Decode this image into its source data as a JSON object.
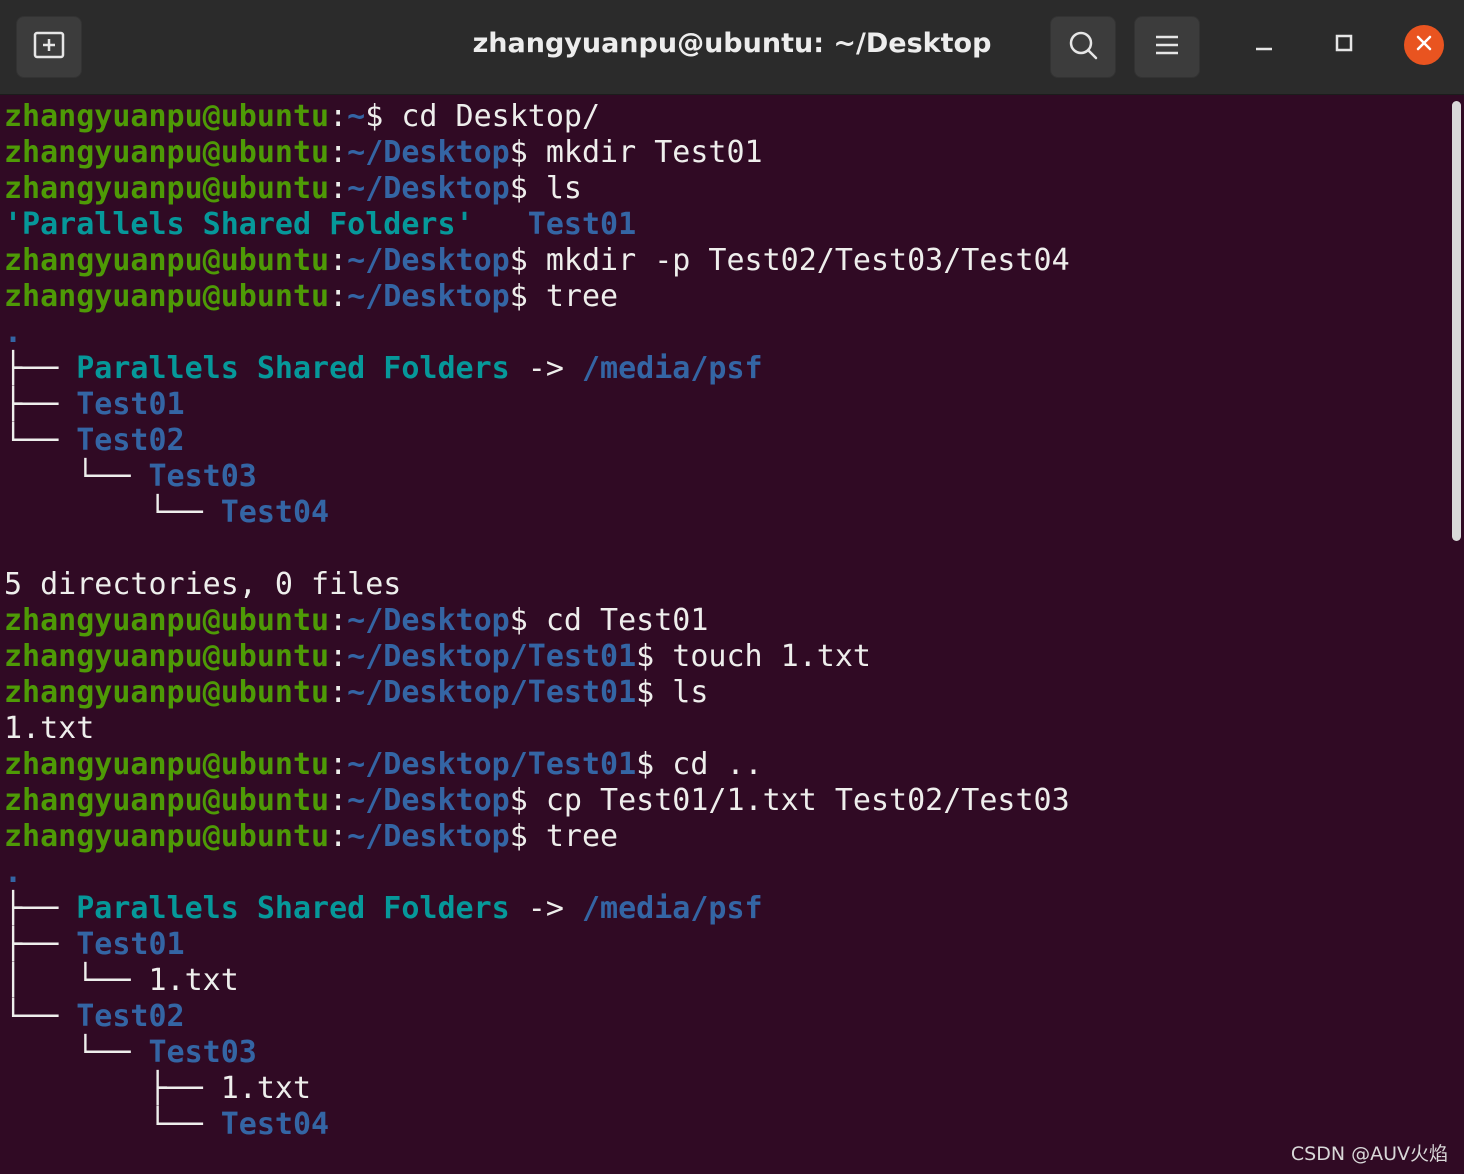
{
  "window": {
    "title": "zhangyuanpu@ubuntu: ~/Desktop"
  },
  "colors": {
    "user": "#4e9a06",
    "path": "#3465a4",
    "background": "#300a24",
    "close": "#e95420",
    "link": "#06989a"
  },
  "icons": [
    "new-tab-icon",
    "search-icon",
    "hamburger-menu-icon",
    "minimize-icon",
    "maximize-icon",
    "close-icon"
  ],
  "terminal": {
    "lines": [
      [
        {
          "t": "zhangyuanpu@ubuntu",
          "c": "u"
        },
        {
          "t": ":",
          "c": "c"
        },
        {
          "t": "~",
          "c": "p"
        },
        {
          "t": "$ cd Desktop/",
          "c": "c"
        }
      ],
      [
        {
          "t": "zhangyuanpu@ubuntu",
          "c": "u"
        },
        {
          "t": ":",
          "c": "c"
        },
        {
          "t": "~/Desktop",
          "c": "p"
        },
        {
          "t": "$ mkdir Test01",
          "c": "c"
        }
      ],
      [
        {
          "t": "zhangyuanpu@ubuntu",
          "c": "u"
        },
        {
          "t": ":",
          "c": "c"
        },
        {
          "t": "~/Desktop",
          "c": "p"
        },
        {
          "t": "$ ls",
          "c": "c"
        }
      ],
      [
        {
          "t": "'Parallels Shared Folders'",
          "c": "sh"
        },
        {
          "t": "   ",
          "c": "c"
        },
        {
          "t": "Test01",
          "c": "dir"
        }
      ],
      [
        {
          "t": "zhangyuanpu@ubuntu",
          "c": "u"
        },
        {
          "t": ":",
          "c": "c"
        },
        {
          "t": "~/Desktop",
          "c": "p"
        },
        {
          "t": "$ mkdir -p Test02/Test03/Test04",
          "c": "c"
        }
      ],
      [
        {
          "t": "zhangyuanpu@ubuntu",
          "c": "u"
        },
        {
          "t": ":",
          "c": "c"
        },
        {
          "t": "~/Desktop",
          "c": "p"
        },
        {
          "t": "$ tree",
          "c": "c"
        }
      ],
      [
        {
          "t": ".",
          "c": "dir"
        }
      ],
      [
        {
          "t": "├── ",
          "c": "tr"
        },
        {
          "t": "Parallels Shared Folders",
          "c": "sh"
        },
        {
          "t": " -> ",
          "c": "c"
        },
        {
          "t": "/media/psf",
          "c": "dir"
        }
      ],
      [
        {
          "t": "├── ",
          "c": "tr"
        },
        {
          "t": "Test01",
          "c": "dir"
        }
      ],
      [
        {
          "t": "└── ",
          "c": "tr"
        },
        {
          "t": "Test02",
          "c": "dir"
        }
      ],
      [
        {
          "t": "    └── ",
          "c": "tr"
        },
        {
          "t": "Test03",
          "c": "dir"
        }
      ],
      [
        {
          "t": "        └── ",
          "c": "tr"
        },
        {
          "t": "Test04",
          "c": "dir"
        }
      ],
      [
        {
          "t": "",
          "c": "c"
        }
      ],
      [
        {
          "t": "5 directories, 0 files",
          "c": "c"
        }
      ],
      [
        {
          "t": "zhangyuanpu@ubuntu",
          "c": "u"
        },
        {
          "t": ":",
          "c": "c"
        },
        {
          "t": "~/Desktop",
          "c": "p"
        },
        {
          "t": "$ cd Test01",
          "c": "c"
        }
      ],
      [
        {
          "t": "zhangyuanpu@ubuntu",
          "c": "u"
        },
        {
          "t": ":",
          "c": "c"
        },
        {
          "t": "~/Desktop/Test01",
          "c": "p"
        },
        {
          "t": "$ touch 1.txt",
          "c": "c"
        }
      ],
      [
        {
          "t": "zhangyuanpu@ubuntu",
          "c": "u"
        },
        {
          "t": ":",
          "c": "c"
        },
        {
          "t": "~/Desktop/Test01",
          "c": "p"
        },
        {
          "t": "$ ls",
          "c": "c"
        }
      ],
      [
        {
          "t": "1.txt",
          "c": "c"
        }
      ],
      [
        {
          "t": "zhangyuanpu@ubuntu",
          "c": "u"
        },
        {
          "t": ":",
          "c": "c"
        },
        {
          "t": "~/Desktop/Test01",
          "c": "p"
        },
        {
          "t": "$ cd ..",
          "c": "c"
        }
      ],
      [
        {
          "t": "zhangyuanpu@ubuntu",
          "c": "u"
        },
        {
          "t": ":",
          "c": "c"
        },
        {
          "t": "~/Desktop",
          "c": "p"
        },
        {
          "t": "$ cp Test01/1.txt Test02/Test03",
          "c": "c"
        }
      ],
      [
        {
          "t": "zhangyuanpu@ubuntu",
          "c": "u"
        },
        {
          "t": ":",
          "c": "c"
        },
        {
          "t": "~/Desktop",
          "c": "p"
        },
        {
          "t": "$ tree",
          "c": "c"
        }
      ],
      [
        {
          "t": ".",
          "c": "dir"
        }
      ],
      [
        {
          "t": "├── ",
          "c": "tr"
        },
        {
          "t": "Parallels Shared Folders",
          "c": "sh"
        },
        {
          "t": " -> ",
          "c": "c"
        },
        {
          "t": "/media/psf",
          "c": "dir"
        }
      ],
      [
        {
          "t": "├── ",
          "c": "tr"
        },
        {
          "t": "Test01",
          "c": "dir"
        }
      ],
      [
        {
          "t": "│   └── ",
          "c": "tr"
        },
        {
          "t": "1.txt",
          "c": "c"
        }
      ],
      [
        {
          "t": "└── ",
          "c": "tr"
        },
        {
          "t": "Test02",
          "c": "dir"
        }
      ],
      [
        {
          "t": "    └── ",
          "c": "tr"
        },
        {
          "t": "Test03",
          "c": "dir"
        }
      ],
      [
        {
          "t": "        ├── ",
          "c": "tr"
        },
        {
          "t": "1.txt",
          "c": "c"
        }
      ],
      [
        {
          "t": "        └── ",
          "c": "tr"
        },
        {
          "t": "Test04",
          "c": "dir"
        }
      ]
    ]
  },
  "watermark": "CSDN @AUV火焰"
}
